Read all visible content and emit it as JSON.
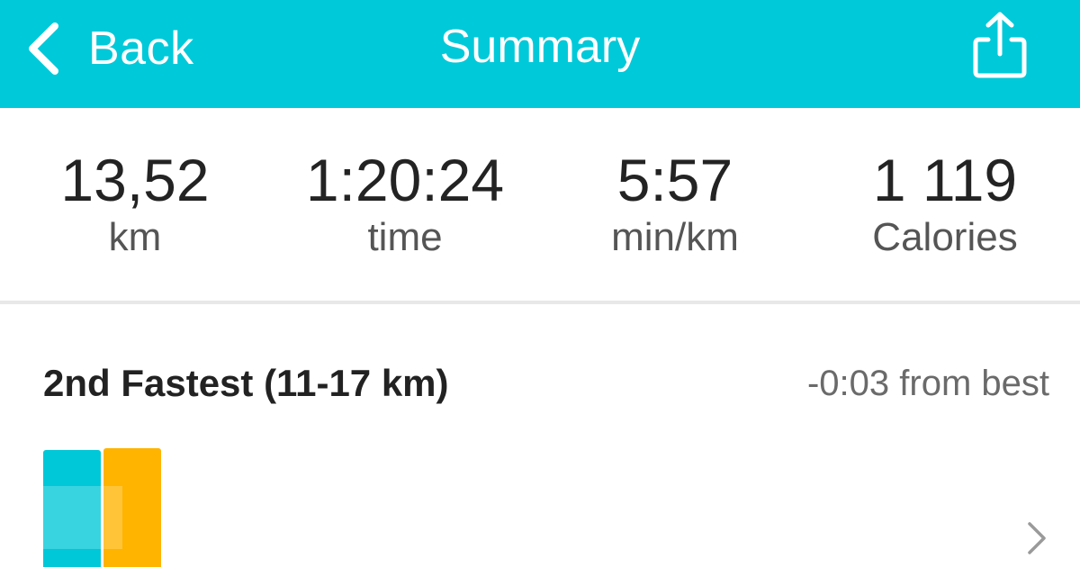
{
  "colors": {
    "header_bg": "#00c9d9",
    "accent_blue": "#00c8d8",
    "accent_orange": "#ffb400"
  },
  "header": {
    "back_label": "Back",
    "back_icon": "chevron-left-icon",
    "title": "Summary",
    "share_icon": "share-icon"
  },
  "stats": [
    {
      "value": "13,52",
      "unit": "km"
    },
    {
      "value": "1:20:24",
      "unit": "time"
    },
    {
      "value": "5:57",
      "unit": "min/km"
    },
    {
      "value": "1 119",
      "unit": "Calories"
    }
  ],
  "fastest": {
    "title": "2nd Fastest (11-17 km)",
    "diff": "-0:03 from best",
    "chevron_icon": "chevron-right-icon"
  }
}
